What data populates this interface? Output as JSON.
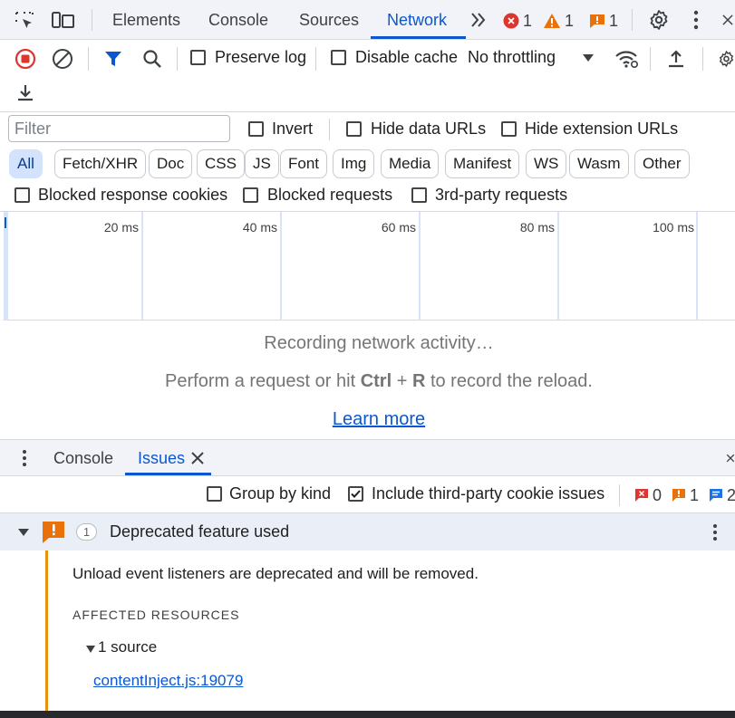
{
  "tabs": [
    {
      "label": "Elements"
    },
    {
      "label": "Console"
    },
    {
      "label": "Sources"
    },
    {
      "label": "Network"
    }
  ],
  "active_tab": "Network",
  "status_badges": {
    "errors": "1",
    "warnings": "1",
    "issues": "1"
  },
  "toolbar": {
    "preserve_log": "Preserve log",
    "disable_cache": "Disable cache",
    "throttling": "No throttling"
  },
  "filter": {
    "placeholder": "Filter",
    "invert": "Invert",
    "hide_data_urls": "Hide data URLs",
    "hide_extension_urls": "Hide extension URLs",
    "types": [
      "All",
      "Fetch/XHR",
      "Doc",
      "CSS",
      "JS",
      "Font",
      "Img",
      "Media",
      "Manifest",
      "WS",
      "Wasm",
      "Other"
    ],
    "active_type": "All",
    "blocked_response_cookies": "Blocked response cookies",
    "blocked_requests": "Blocked requests",
    "third_party_requests": "3rd-party requests"
  },
  "timeline": {
    "ticks": [
      "20 ms",
      "40 ms",
      "60 ms",
      "80 ms",
      "100 ms"
    ]
  },
  "empty_state": {
    "recording": "Recording network activity…",
    "hint_before": "Perform a request or hit ",
    "key_ctrl": "Ctrl",
    "key_plus": " + ",
    "key_r": "R",
    "hint_after": " to record the reload.",
    "learn_more": "Learn more"
  },
  "drawer": {
    "tabs": [
      {
        "label": "Console"
      },
      {
        "label": "Issues"
      }
    ],
    "active_tab": "Issues",
    "group_by_kind": "Group by kind",
    "include_third_party": "Include third-party cookie issues",
    "counts": {
      "errors": "0",
      "warnings": "1",
      "info": "2"
    }
  },
  "issue": {
    "count": "1",
    "title": "Deprecated feature used",
    "description": "Unload event listeners are deprecated and will be removed.",
    "affected_heading": "AFFECTED RESOURCES",
    "source_toggle": "1 source",
    "source_link": "contentInject.js:19079"
  },
  "colors": {
    "accent": "#0b57d0",
    "error": "#dc362e",
    "warning": "#e8710a",
    "issue_orange": "#e8900c",
    "info": "#1a73e8"
  }
}
